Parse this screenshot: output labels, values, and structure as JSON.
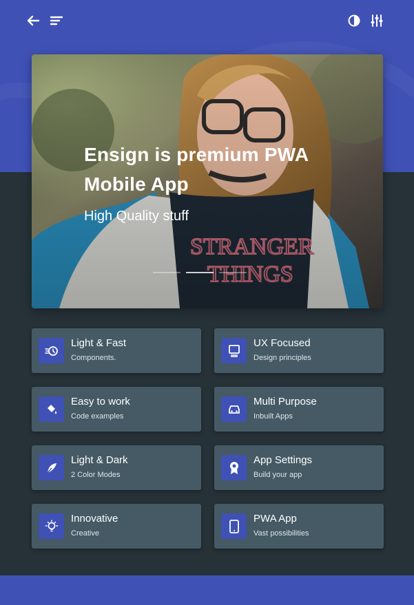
{
  "header": {
    "back_icon": "arrow-left-icon",
    "menu_icon": "menu-lines-icon",
    "theme_icon": "contrast-icon",
    "settings_icon": "sliders-icon"
  },
  "hero": {
    "title": "Ensign is premium PWA Mobile App",
    "subtitle": "High Quality stuff",
    "slides": 3,
    "active_slide": 1
  },
  "features": [
    {
      "title": "Light & Fast",
      "subtitle": "Components.",
      "icon": "timer-icon"
    },
    {
      "title": "UX Focused",
      "subtitle": "Design principles",
      "icon": "monitor-icon"
    },
    {
      "title": "Easy to work",
      "subtitle": "Code examples",
      "icon": "paint-bucket-icon"
    },
    {
      "title": "Multi Purpose",
      "subtitle": "Inbuilt Apps",
      "icon": "car-icon"
    },
    {
      "title": "Light & Dark",
      "subtitle": "2 Color Modes",
      "icon": "feather-icon"
    },
    {
      "title": "App Settings",
      "subtitle": "Build your app",
      "icon": "award-icon"
    },
    {
      "title": "Innovative",
      "subtitle": "Creative",
      "icon": "lightbulb-icon"
    },
    {
      "title": "PWA App",
      "subtitle": "Vast possibilities",
      "icon": "mobile-icon"
    }
  ],
  "colors": {
    "primary": "#3f51b5",
    "background": "#263238",
    "card": "#455a64"
  }
}
